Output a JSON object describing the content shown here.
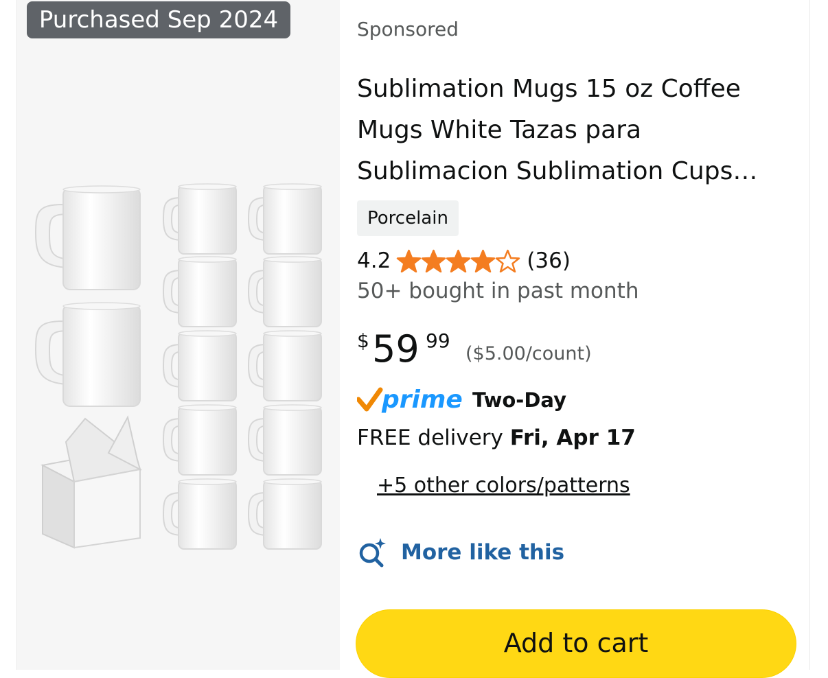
{
  "badge": {
    "purchased": "Purchased Sep 2024"
  },
  "product": {
    "sponsored_label": "Sponsored",
    "title_lines": [
      "Sublimation Mugs 15 oz Coffee",
      "Mugs White Tazas para",
      "Sublimacion Sublimation Cups…"
    ],
    "material_chip": "Porcelain",
    "rating": {
      "value": "4.2",
      "stars_out_of_5": 4.2,
      "count": "(36)",
      "star_color": "#f47d20"
    },
    "bought_text": "50+ bought in past month",
    "price": {
      "symbol": "$",
      "whole": "59",
      "fraction": "99",
      "unit_price": "($5.00/count)"
    },
    "prime": {
      "logo_text": "prime",
      "speed": "Two-Day",
      "check_color": "#f08804",
      "logo_color": "#1a98ff"
    },
    "delivery": {
      "prefix": "FREE delivery",
      "date": "Fri, Apr 17"
    },
    "other_colors_link": "+5 other colors/patterns",
    "more_like_this": {
      "label": "More like this",
      "icon": "sparkle-search-icon",
      "color": "#2162a1"
    },
    "add_to_cart": {
      "label": "Add to cart",
      "color": "#ffd814"
    }
  }
}
